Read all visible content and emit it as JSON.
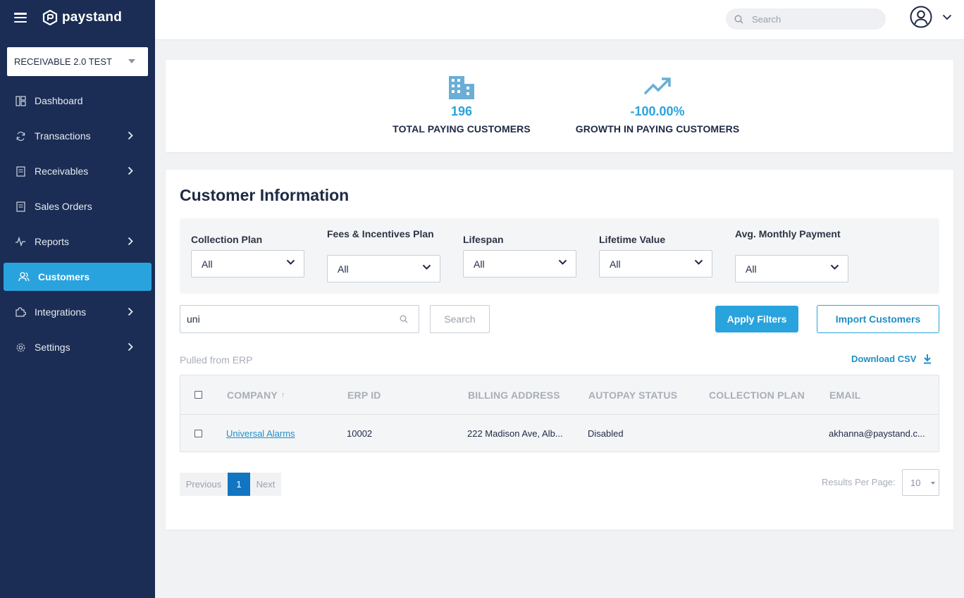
{
  "brand": {
    "name": "paystand"
  },
  "account": {
    "selected": "RECEIVABLE 2.0 TEST"
  },
  "nav": {
    "items": [
      {
        "label": "Dashboard",
        "icon": "dashboard-icon",
        "has_submenu": false
      },
      {
        "label": "Transactions",
        "icon": "refresh-icon",
        "has_submenu": true
      },
      {
        "label": "Receivables",
        "icon": "document-icon",
        "has_submenu": true
      },
      {
        "label": "Sales Orders",
        "icon": "document-icon",
        "has_submenu": false
      },
      {
        "label": "Reports",
        "icon": "pulse-icon",
        "has_submenu": true
      },
      {
        "label": "Customers",
        "icon": "users-icon",
        "has_submenu": false,
        "active": true
      },
      {
        "label": "Integrations",
        "icon": "puzzle-icon",
        "has_submenu": true
      },
      {
        "label": "Settings",
        "icon": "gear-icon",
        "has_submenu": true
      }
    ]
  },
  "topbar": {
    "search_placeholder": "Search"
  },
  "stats": {
    "total_customers": {
      "value": "196",
      "label": "TOTAL PAYING CUSTOMERS",
      "icon": "building-icon"
    },
    "growth": {
      "value": "-100.00%",
      "label": "GROWTH IN PAYING CUSTOMERS",
      "icon": "trending-up-icon"
    }
  },
  "main": {
    "title": "Customer Information",
    "filters": [
      {
        "label": "Collection Plan",
        "value": "All"
      },
      {
        "label": "Fees & Incentives Plan",
        "value": "All"
      },
      {
        "label": "Lifespan",
        "value": "All"
      },
      {
        "label": "Lifetime Value",
        "value": "All"
      },
      {
        "label": "Avg. Monthly Payment",
        "value": "All"
      }
    ],
    "search": {
      "value": "uni",
      "button": "Search"
    },
    "apply_filters": "Apply Filters",
    "import_customers": "Import Customers",
    "source_note": "Pulled from ERP",
    "download_csv": "Download CSV",
    "table": {
      "columns": [
        "COMPANY",
        "ERP ID",
        "BILLING ADDRESS",
        "AUTOPAY STATUS",
        "COLLECTION PLAN",
        "EMAIL"
      ],
      "sort_indicator": "↑",
      "rows": [
        {
          "company": "Universal Alarms",
          "erp_id": "10002",
          "billing_address": "222 Madison Ave, Alb...",
          "autopay_status": "Disabled",
          "collection_plan": "",
          "email": "akhanna@paystand.c..."
        }
      ]
    },
    "pagination": {
      "previous": "Previous",
      "current": "1",
      "next": "Next"
    },
    "results_per_page": {
      "label": "Results Per Page:",
      "value": "10"
    }
  },
  "colors": {
    "sidebar": "#1b2d54",
    "accent": "#29a3de",
    "active_page": "#1275c1"
  }
}
